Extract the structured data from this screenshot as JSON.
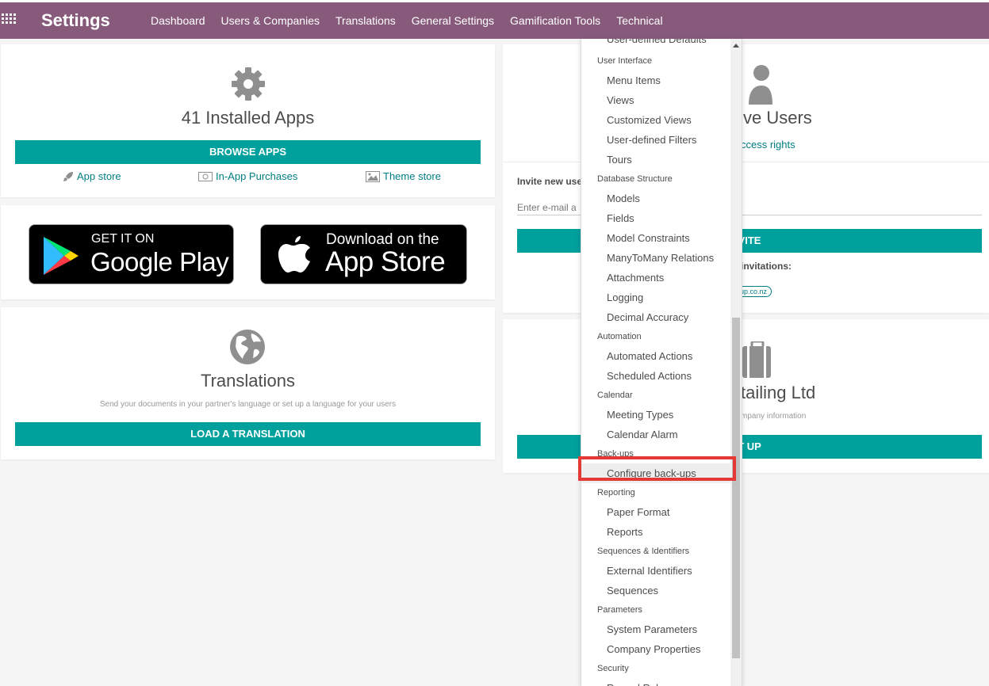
{
  "topbar": {
    "brand": "Settings",
    "menu": [
      "Dashboard",
      "Users & Companies",
      "Translations",
      "General Settings",
      "Gamification Tools",
      "Technical"
    ]
  },
  "apps_card": {
    "title": "41 Installed Apps",
    "button": "BROWSE APPS",
    "links": [
      {
        "label": "App store",
        "icon": "rocket-icon"
      },
      {
        "label": "In-App Purchases",
        "icon": "money-icon"
      },
      {
        "label": "Theme store",
        "icon": "image-icon"
      }
    ]
  },
  "store_badges": {
    "google": {
      "small": "GET IT ON",
      "big": "Google Play"
    },
    "apple": {
      "small": "Download on the",
      "big": "App Store"
    }
  },
  "translations_card": {
    "title": "Translations",
    "subtitle": "Send your documents in your partner's language or set up a language for your users",
    "button": "LOAD A TRANSLATION"
  },
  "users_card": {
    "title_visible": "ve Users",
    "link_visible": "ccess rights"
  },
  "invite_card": {
    "label": "Invite new use",
    "placeholder": "Enter e-mail a",
    "button_visible": "VITE",
    "pending_label": "invitations:",
    "pending_email": "group.co.nz"
  },
  "company_card": {
    "title_visible": "tailing Ltd",
    "subtitle_visible": "mpany information",
    "button_visible": "T UP"
  },
  "dropdown": {
    "first_item_partial": "User-defined Defaults",
    "sections": [
      {
        "header": "User Interface",
        "items": [
          "Menu Items",
          "Views",
          "Customized Views",
          "User-defined Filters",
          "Tours"
        ]
      },
      {
        "header": "Database Structure",
        "items": [
          "Models",
          "Fields",
          "Model Constraints",
          "ManyToMany Relations",
          "Attachments",
          "Logging",
          "Decimal Accuracy"
        ]
      },
      {
        "header": "Automation",
        "items": [
          "Automated Actions",
          "Scheduled Actions"
        ]
      },
      {
        "header": "Calendar",
        "items": [
          "Meeting Types",
          "Calendar Alarm"
        ]
      },
      {
        "header": "Back-ups",
        "items": [
          "Configure back-ups"
        ]
      },
      {
        "header": "Reporting",
        "items": [
          "Paper Format",
          "Reports"
        ]
      },
      {
        "header": "Sequences & Identifiers",
        "items": [
          "External Identifiers",
          "Sequences"
        ]
      },
      {
        "header": "Parameters",
        "items": [
          "System Parameters",
          "Company Properties"
        ]
      },
      {
        "header": "Security",
        "items": [
          "Record Rules"
        ]
      }
    ],
    "highlighted_item": "Configure back-ups"
  },
  "colors": {
    "topbar": "#875a7b",
    "teal": "#00a09d",
    "link": "#017e84",
    "highlight": "#e53935"
  }
}
